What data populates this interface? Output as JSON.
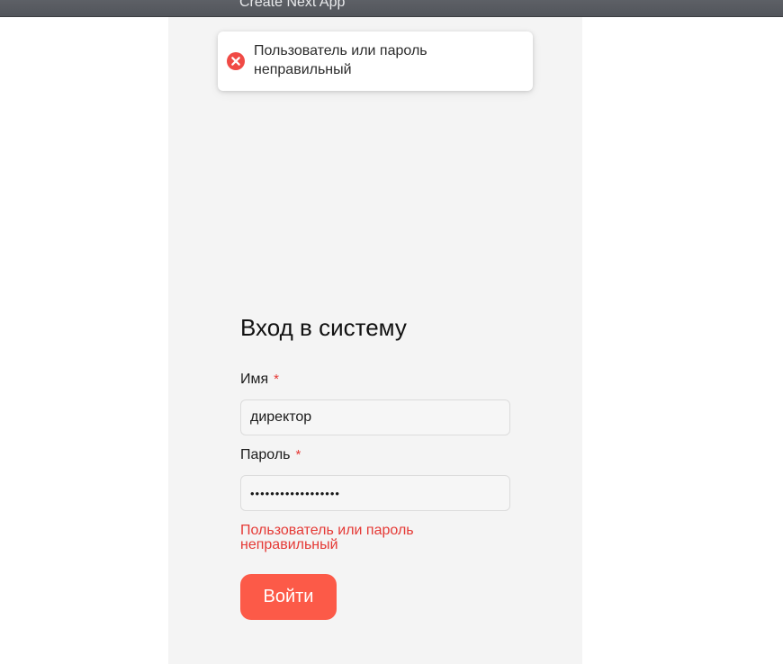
{
  "browser": {
    "tab_title": "Create Next App"
  },
  "toast": {
    "icon": "error-circle-x-icon",
    "message": "Пользователь или пароль неправильный",
    "accent_color": "#f04a45"
  },
  "login_form": {
    "title": "Вход в систему",
    "username": {
      "label": "Имя",
      "required_mark": "*",
      "value": "директор"
    },
    "password": {
      "label": "Пароль",
      "required_mark": "*",
      "value": "••••••••••••••••••"
    },
    "error_message": "Пользователь или пароль неправильный",
    "submit_label": "Войти",
    "submit_color": "#fc5a48",
    "error_color": "#e53935"
  }
}
